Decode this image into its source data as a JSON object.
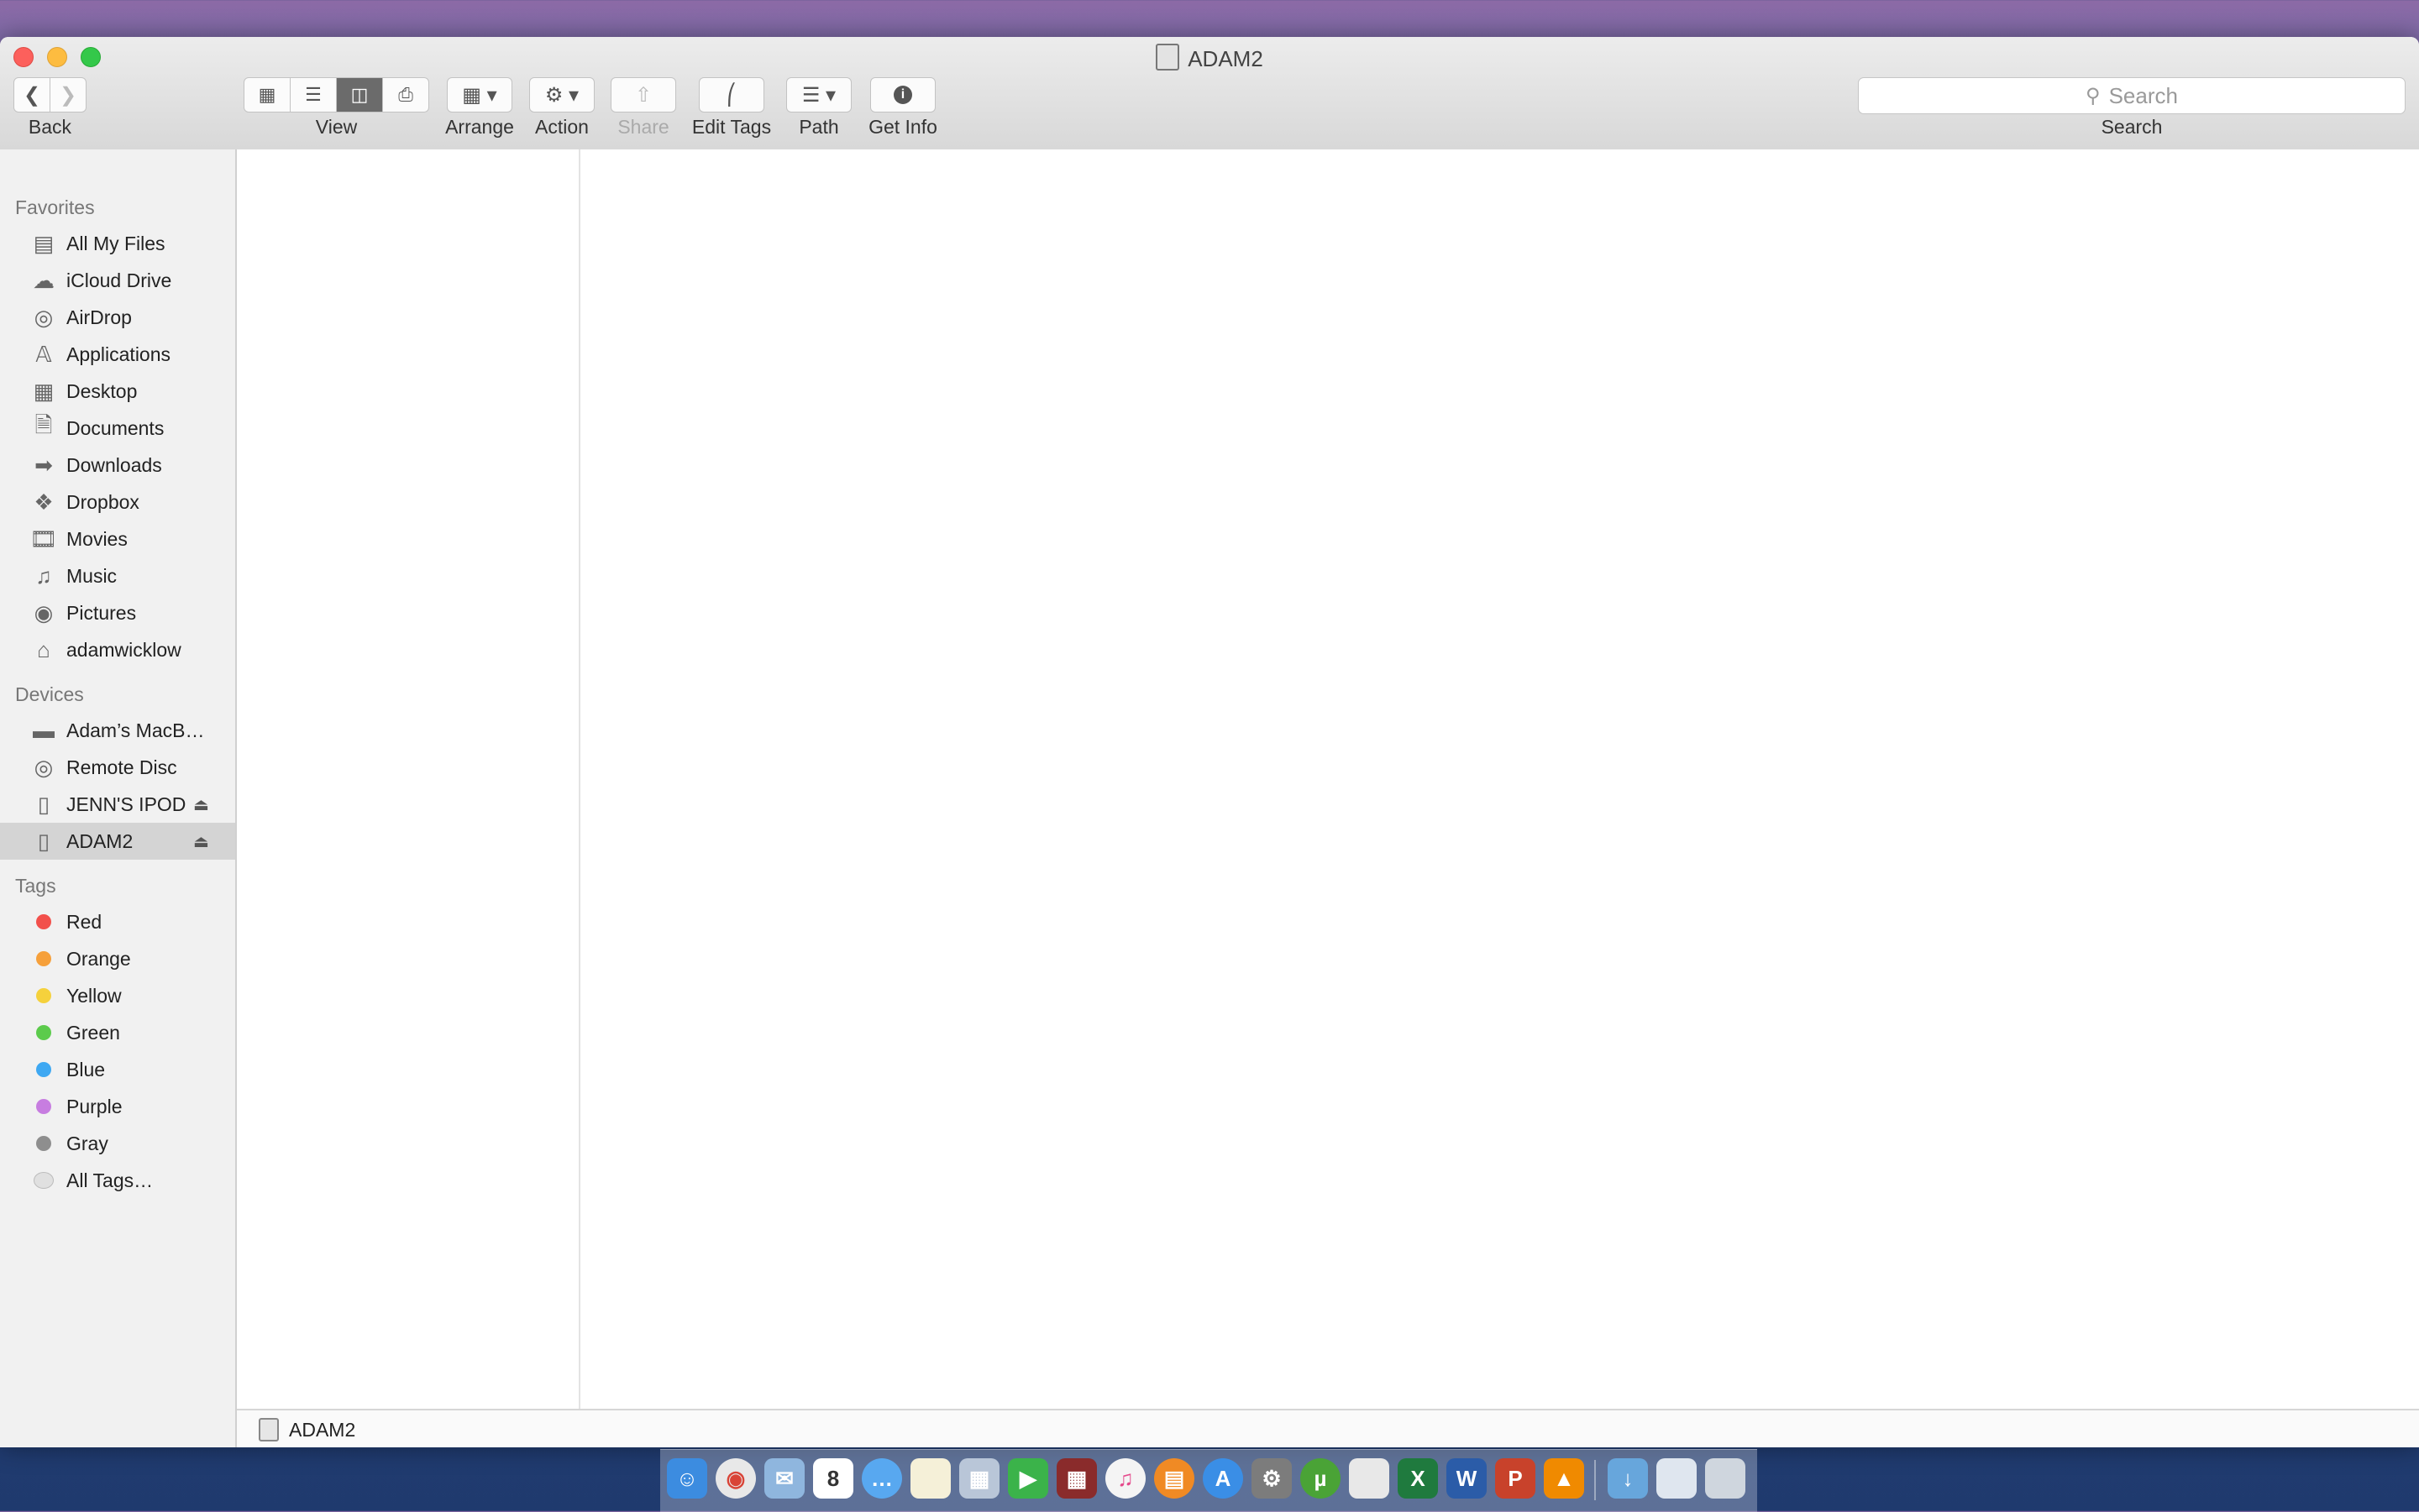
{
  "window": {
    "title": "ADAM2",
    "traffic_lights": [
      "#fc605c",
      "#fdbc40",
      "#34c84a"
    ]
  },
  "toolbar": {
    "back_label": "Back",
    "view_label": "View",
    "arrange_label": "Arrange",
    "action_label": "Action",
    "share_label": "Share",
    "edit_tags_label": "Edit Tags",
    "path_label": "Path",
    "get_info_label": "Get Info",
    "search_placeholder": "Search",
    "search_label": "Search",
    "active_view": "columns"
  },
  "sidebar": {
    "favorites_header": "Favorites",
    "favorites": [
      {
        "label": "All My Files",
        "icon": "all-files-icon"
      },
      {
        "label": "iCloud Drive",
        "icon": "cloud-icon"
      },
      {
        "label": "AirDrop",
        "icon": "airdrop-icon"
      },
      {
        "label": "Applications",
        "icon": "applications-icon"
      },
      {
        "label": "Desktop",
        "icon": "desktop-icon"
      },
      {
        "label": "Documents",
        "icon": "documents-icon"
      },
      {
        "label": "Downloads",
        "icon": "downloads-icon"
      },
      {
        "label": "Dropbox",
        "icon": "dropbox-icon"
      },
      {
        "label": "Movies",
        "icon": "movies-icon"
      },
      {
        "label": "Music",
        "icon": "music-icon"
      },
      {
        "label": "Pictures",
        "icon": "pictures-icon"
      },
      {
        "label": "adamwicklow",
        "icon": "home-icon"
      }
    ],
    "devices_header": "Devices",
    "devices": [
      {
        "label": "Adam’s MacB…",
        "icon": "laptop-icon"
      },
      {
        "label": "Remote Disc",
        "icon": "disc-icon"
      },
      {
        "label": "JENN'S IPOD",
        "icon": "drive-icon"
      },
      {
        "label": "ADAM2",
        "icon": "drive-icon"
      }
    ],
    "tags_header": "Tags",
    "tags": [
      {
        "label": "Red",
        "color": "#f2504b"
      },
      {
        "label": "Orange",
        "color": "#f6a03b"
      },
      {
        "label": "Yellow",
        "color": "#f5d13c"
      },
      {
        "label": "Green",
        "color": "#5ccb4c"
      },
      {
        "label": "Blue",
        "color": "#3ea8f2"
      },
      {
        "label": "Purple",
        "color": "#c77de0"
      },
      {
        "label": "Gray",
        "color": "#8e8e8e"
      },
      {
        "label": "All Tags…",
        "color": "#e0e0e0"
      }
    ]
  },
  "pathbar": {
    "label": "ADAM2"
  },
  "dock": {
    "calendar_day": "8",
    "apps": [
      "finder-icon",
      "chrome-icon",
      "mail-icon",
      "calendar-icon",
      "messages-icon",
      "notes-icon",
      "preview-icon",
      "facetime-icon",
      "photo-booth-icon",
      "itunes-icon",
      "ibooks-icon",
      "app-store-icon",
      "system-preferences-icon",
      "utorrent-icon",
      "script-icon",
      "excel-icon",
      "word-icon",
      "powerpoint-icon",
      "vlc-icon",
      "downloads-folder-icon",
      "documents-stack-icon",
      "trash-icon"
    ]
  }
}
